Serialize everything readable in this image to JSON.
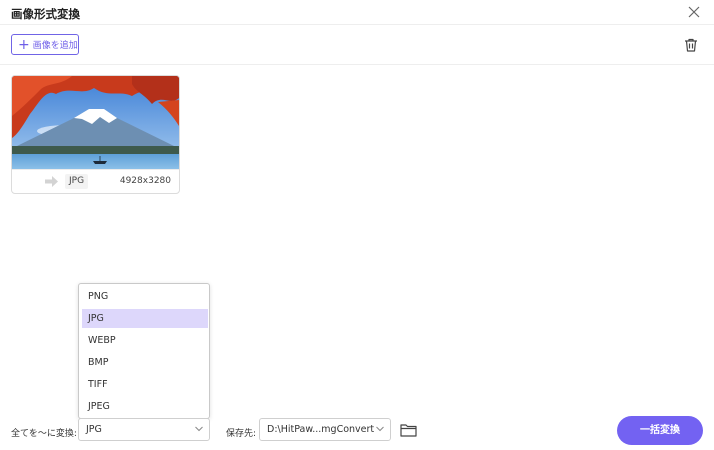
{
  "window": {
    "title": "画像形式変換"
  },
  "toolbar": {
    "add_label": "画像を追加"
  },
  "image_card": {
    "format": "JPG",
    "dimensions": "4928x3280"
  },
  "dropdown": {
    "options": [
      "PNG",
      "JPG",
      "WEBP",
      "BMP",
      "TIFF",
      "JPEG"
    ],
    "selected": "JPG"
  },
  "footer": {
    "convert_all_label": "全てを～に変換:",
    "format_value": "JPG",
    "save_label": "保存先:",
    "save_path": "D:\\HitPaw...mgConvert",
    "convert_button": "一括変換"
  },
  "colors": {
    "accent": "#7362f2",
    "selected_bg": "#ddd7fb"
  }
}
